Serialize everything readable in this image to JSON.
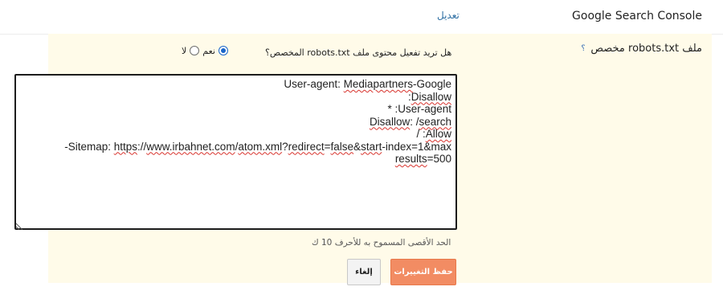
{
  "header": {
    "title": "Google Search Console",
    "edit_link": "تعديل"
  },
  "robots_section": {
    "label": "ملف robots.txt مخصص",
    "help_icon": "؟",
    "question": "هل تريد تفعيل محتوى ملف robots.txt المخصص؟",
    "options": {
      "yes_label": "نعم",
      "no_label": "لا",
      "selected": "yes"
    },
    "editor_lines": {
      "l1a": "User-agent: ",
      "l1b": "Mediapartners",
      "l1c": "-Google",
      "l2a": "Disallow",
      "l2b": ":",
      "l3": "User-agent: *",
      "l4a": "Disallow",
      "l4b": ": /",
      "l4c": "search",
      "l5a": "Allow",
      "l5b": ": /",
      "l6a": "Sitemap: ",
      "l6b": "https",
      "l6c": "://",
      "l6d": "www.irbahnet.com",
      "l6e": "/",
      "l6f": "atom.xml",
      "l6g": "?",
      "l6h": "redirect",
      "l6i": "=",
      "l6j": "false",
      "l6k": "&",
      "l6l": "start",
      "l6m": "-index=1&max-",
      "l7a": "results",
      "l7b": "=500"
    },
    "max_note": "الحد الأقصى المسموح به للأحرف 10 ك",
    "buttons": {
      "cancel": "إلغاء",
      "save": "حفظ التغييرات"
    }
  },
  "colors": {
    "section_bg": "#fffbe9",
    "link": "#2f6fa3",
    "save_bg": "#f28c63",
    "radio_checked": "#1a66c9",
    "spellcheck": "#d8332d"
  },
  "icons": {
    "help": "question-mark-icon",
    "resize": "resize-grip-icon"
  }
}
